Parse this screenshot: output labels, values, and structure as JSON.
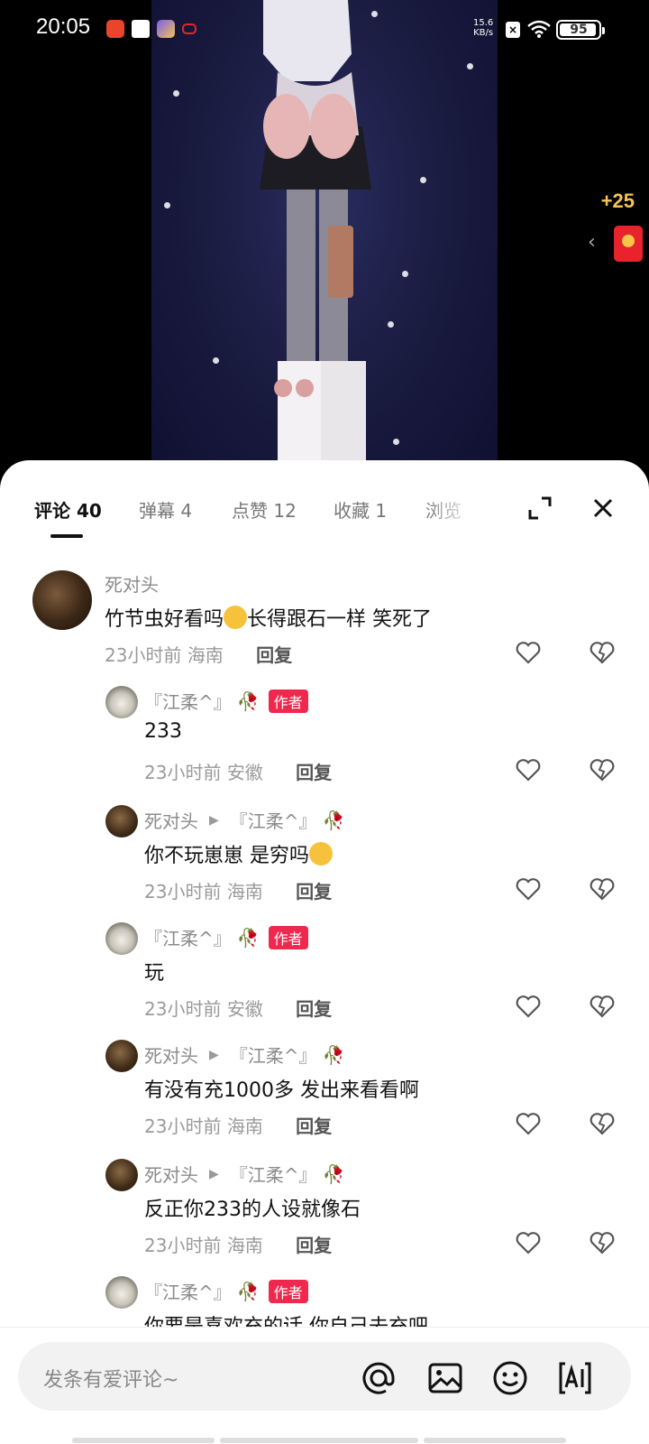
{
  "status_bar": {
    "time": "20:05",
    "net_speed_value": "15.6",
    "net_speed_unit": "KB/s",
    "battery": "95",
    "battery_level": 0.95
  },
  "video": {
    "reward_text": "+25",
    "reward_arrow": "‹"
  },
  "tabs": [
    {
      "label": "评论 40"
    },
    {
      "label": "弹幕 4"
    },
    {
      "label": "点赞 12"
    },
    {
      "label": "收藏 1"
    },
    {
      "label": "浏览"
    }
  ],
  "comments": [
    {
      "name": "死对头",
      "text_a": "竹节虫好看吗",
      "text_b": "长得跟石一样  笑死了",
      "time": "23小时前",
      "location": "海南",
      "reply": "回复"
    },
    {
      "name": "『江柔^』",
      "badge": "作者",
      "text": "233",
      "time": "23小时前",
      "location": "安徽",
      "reply": "回复"
    },
    {
      "name": "死对头",
      "reply_to": "『江柔^』",
      "text": "你不玩崽崽  是穷吗",
      "time": "23小时前",
      "location": "海南",
      "reply": "回复"
    },
    {
      "name": "『江柔^』",
      "badge": "作者",
      "text": "玩",
      "time": "23小时前",
      "location": "安徽",
      "reply": "回复"
    },
    {
      "name": "死对头",
      "reply_to": "『江柔^』",
      "text": "有没有充1000多  发出来看看啊",
      "time": "23小时前",
      "location": "海南",
      "reply": "回复"
    },
    {
      "name": "死对头",
      "reply_to": "『江柔^』",
      "text": "反正你233的人设就像石",
      "time": "23小时前",
      "location": "海南",
      "reply": "回复"
    },
    {
      "name": "『江柔^』",
      "badge": "作者",
      "text": "你要是喜欢充的话  你自己去充吧"
    }
  ],
  "bottom_bar": {
    "placeholder": "发条有爱评论~"
  },
  "colors": {
    "author_badge": "#f0284e",
    "reward": "#f5c451",
    "red_envelope": "#e8232c"
  },
  "icons": [
    "mention-icon",
    "image-icon",
    "emoji-icon",
    "ai-icon",
    "heart-icon",
    "broken-heart-icon",
    "expand-icon",
    "close-icon"
  ]
}
